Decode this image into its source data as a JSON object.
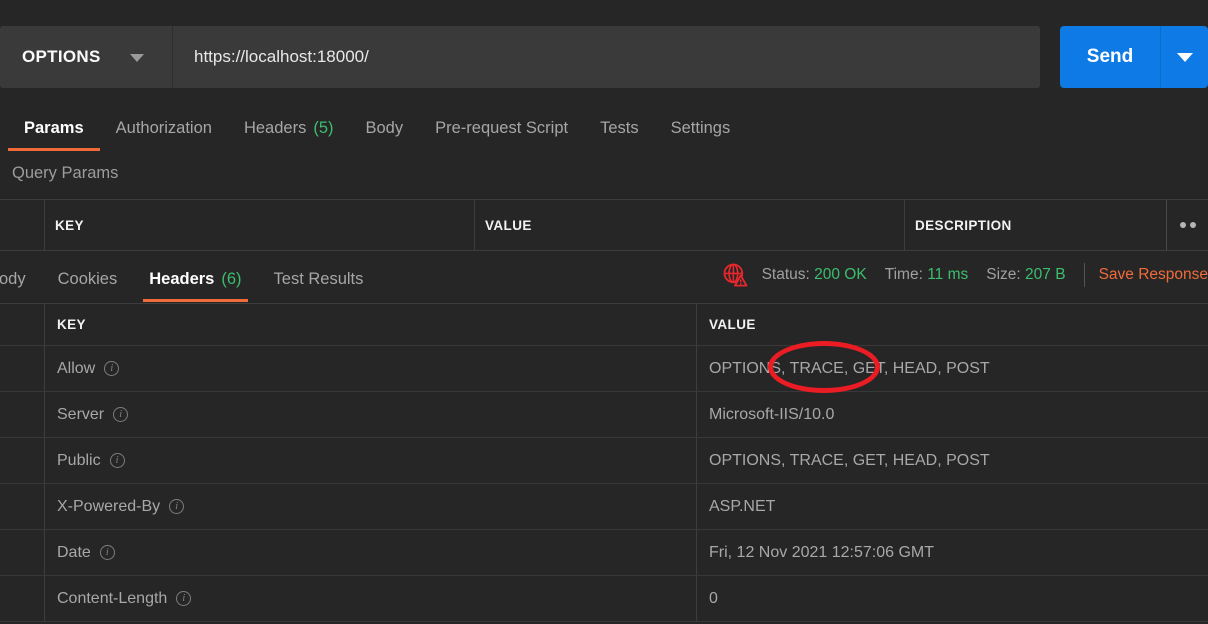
{
  "request": {
    "method": "OPTIONS",
    "url": "https://localhost:18000/",
    "send_label": "Send",
    "method_caret_icon": "chevron-down-icon",
    "send_caret_icon": "chevron-down-icon"
  },
  "request_tabs": [
    {
      "label": "Params",
      "count": "",
      "active": true
    },
    {
      "label": "Authorization",
      "count": "",
      "active": false
    },
    {
      "label": "Headers",
      "count": "(5)",
      "active": false
    },
    {
      "label": "Body",
      "count": "",
      "active": false
    },
    {
      "label": "Pre-request Script",
      "count": "",
      "active": false
    },
    {
      "label": "Tests",
      "count": "",
      "active": false
    },
    {
      "label": "Settings",
      "count": "",
      "active": false
    }
  ],
  "query_params": {
    "section_label": "Query Params",
    "columns": [
      "KEY",
      "VALUE",
      "DESCRIPTION"
    ],
    "bulk_edit_icon": "ellipsis-icon",
    "rows": []
  },
  "response_tabs": [
    {
      "label": "Body",
      "count": "",
      "active": false
    },
    {
      "label": "Cookies",
      "count": "",
      "active": false
    },
    {
      "label": "Headers",
      "count": "(6)",
      "active": true
    },
    {
      "label": "Test Results",
      "count": "",
      "active": false
    }
  ],
  "response_meta": {
    "warning_icon": "globe-warning-icon",
    "status_label": "Status:",
    "status_value": "200 OK",
    "time_label": "Time:",
    "time_value": "11 ms",
    "size_label": "Size:",
    "size_value": "207 B",
    "save_response_label": "Save Response"
  },
  "response_headers": {
    "columns": {
      "key": "KEY",
      "value": "VALUE"
    },
    "info_icon": "info-icon",
    "rows": [
      {
        "key": "Allow",
        "value": "OPTIONS, TRACE, GET, HEAD, POST"
      },
      {
        "key": "Server",
        "value": "Microsoft-IIS/10.0"
      },
      {
        "key": "Public",
        "value": "OPTIONS, TRACE, GET, HEAD, POST"
      },
      {
        "key": "X-Powered-By",
        "value": "ASP.NET"
      },
      {
        "key": "Date",
        "value": "Fri, 12 Nov 2021 12:57:06 GMT"
      },
      {
        "key": "Content-Length",
        "value": "0"
      }
    ]
  },
  "annotation": {
    "shape": "ellipse",
    "color": "#ec1c24",
    "targets": "TRACE in Allow header value"
  },
  "colors": {
    "background": "#262626",
    "input_bg": "#3a3a3a",
    "accent_orange": "#ef6c3a",
    "send_blue": "#0d7ae5",
    "status_green": "#3dbd6e",
    "annotation_red": "#ec1c24"
  }
}
